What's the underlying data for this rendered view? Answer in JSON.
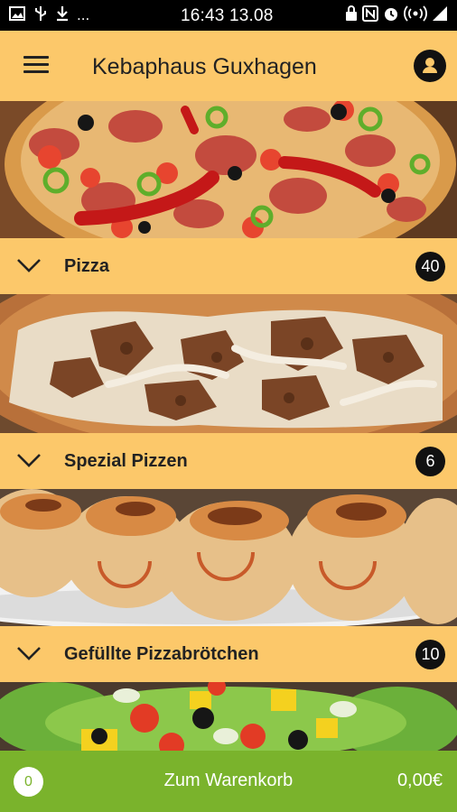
{
  "status_bar": {
    "time_date": "16:43 13.08",
    "overflow": "...",
    "left_icons": [
      "image-icon",
      "usb-icon",
      "download-icon"
    ],
    "right_icons": [
      "lock-icon",
      "nfc-icon",
      "alarm-icon",
      "hotspot-icon",
      "signal-icon"
    ]
  },
  "header": {
    "title": "Kebaphaus Guxhagen",
    "menu_icon": "hamburger-menu-icon",
    "account_icon": "user-icon"
  },
  "categories": [
    {
      "label": "Pizza",
      "count": "40",
      "image": "pizza-salami-photo"
    },
    {
      "label": "Spezial Pizzen",
      "count": "6",
      "image": "doner-pizza-photo"
    },
    {
      "label": "Gefüllte Pizzabrötchen",
      "count": "10",
      "image": "pizza-rolls-photo"
    }
  ],
  "next_category_image": "salad-photo",
  "cart": {
    "count": "0",
    "label": "Zum Warenkorb",
    "total": "0,00€"
  },
  "colors": {
    "accent": "#fcc86a",
    "cart": "#7ab32c",
    "badge": "#111111"
  }
}
